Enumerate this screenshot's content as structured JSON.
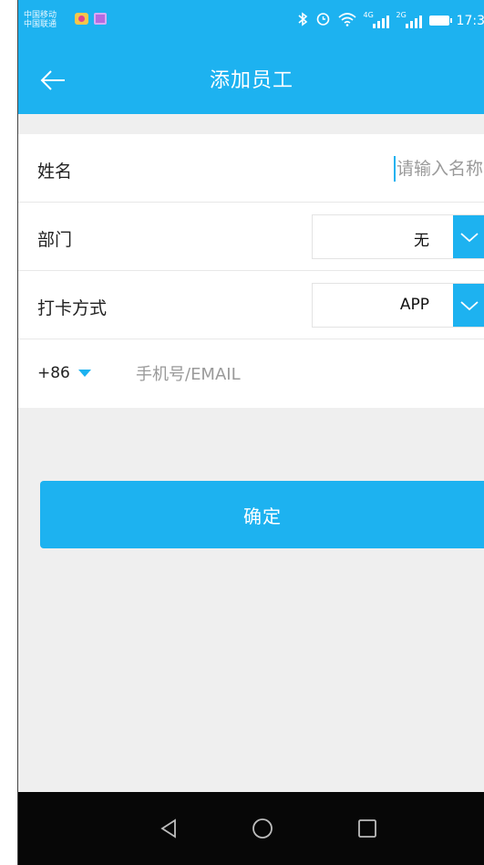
{
  "status_bar": {
    "carrier_line1": "中国移动",
    "carrier_line2": "中国联通",
    "network_4g": "4G",
    "network_2g": "2G",
    "time": "17:3",
    "icons": [
      "bluetooth-icon",
      "alarm-icon",
      "wifi-icon",
      "signal-icon",
      "battery-icon"
    ]
  },
  "header": {
    "title": "添加员工",
    "back_icon": "back-arrow-icon"
  },
  "form": {
    "name": {
      "label": "姓名",
      "value": "",
      "placeholder": "请输入名称"
    },
    "department": {
      "label": "部门",
      "value": "无"
    },
    "checkin_method": {
      "label": "打卡方式",
      "value": "APP"
    },
    "phone": {
      "country_code": "+86",
      "value": "",
      "placeholder": "手机号/EMAIL"
    }
  },
  "actions": {
    "confirm_label": "确定"
  },
  "colors": {
    "accent": "#1db2f0",
    "background": "#efefef",
    "navbar": "#070707"
  }
}
